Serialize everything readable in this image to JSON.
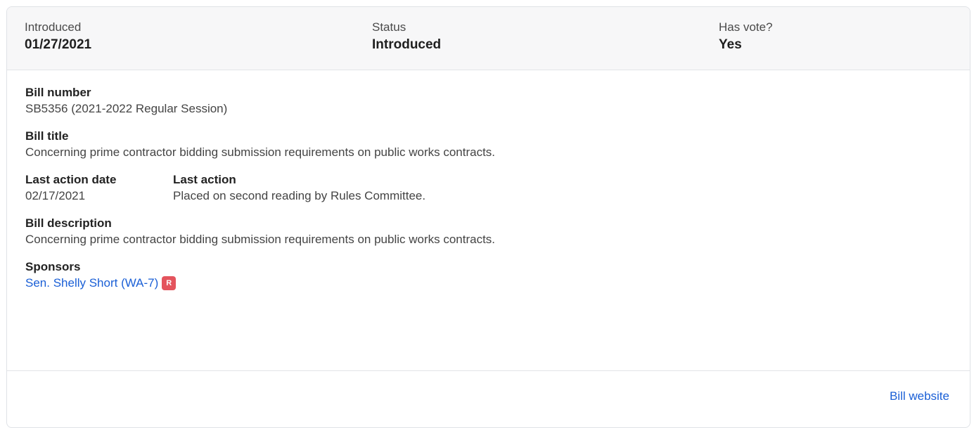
{
  "summary": {
    "introduced_label": "Introduced",
    "introduced_value": "01/27/2021",
    "status_label": "Status",
    "status_value": "Introduced",
    "vote_label": "Has vote?",
    "vote_value": "Yes"
  },
  "details": {
    "bill_number_label": "Bill number",
    "bill_number_value": "SB5356 (2021-2022 Regular Session)",
    "bill_title_label": "Bill title",
    "bill_title_value": "Concerning prime contractor bidding submission requirements on public works contracts.",
    "last_action_date_label": "Last action date",
    "last_action_date_value": "02/17/2021",
    "last_action_label": "Last action",
    "last_action_value": "Placed on second reading by Rules Committee.",
    "bill_description_label": "Bill description",
    "bill_description_value": "Concerning prime contractor bidding submission requirements on public works contracts.",
    "sponsors_label": "Sponsors",
    "sponsors": [
      {
        "name": "Sen. Shelly Short (WA-7)",
        "party": "R",
        "party_color": "#e4545d"
      }
    ]
  },
  "footer": {
    "website_label": "Bill website"
  },
  "colors": {
    "link": "#1a5fd6",
    "summary_bg": "#f7f7f8",
    "border": "#dfe2e6"
  }
}
